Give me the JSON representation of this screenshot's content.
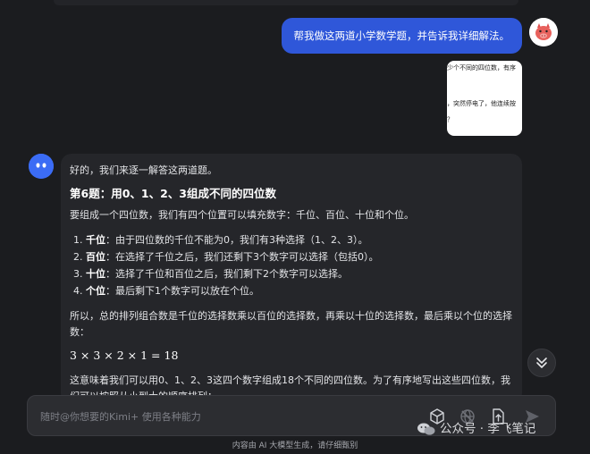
{
  "user_message": "帮我做这两道小学数学题，并告诉我详细解法。",
  "attachment": {
    "lines": [
      "少个不同的四位数，有序",
      "，突然停电了，他连续按",
      "？"
    ]
  },
  "answer": {
    "intro": "好的，我们来逐一解答这两道题。",
    "title": "第6题：用0、1、2、3组成不同的四位数",
    "lead": "要组成一个四位数，我们有四个位置可以填充数字：千位、百位、十位和个位。",
    "steps": [
      {
        "key": "千位",
        "text": "：由于四位数的千位不能为0，我们有3种选择（1、2、3）。"
      },
      {
        "key": "百位",
        "text": "：在选择了千位之后，我们还剩下3个数字可以选择（包括0）。"
      },
      {
        "key": "十位",
        "text": "：选择了千位和百位之后，我们剩下2个数字可以选择。"
      },
      {
        "key": "个位",
        "text": "：最后剩下1个数字可以放在个位。"
      }
    ],
    "summary": "所以，总的排列组合数是千位的选择数乘以百位的选择数，再乘以十位的选择数，最后乘以个位的选择数：",
    "formula": "3 × 3 × 2 × 1 = 18",
    "conclusion": "这意味着我们可以用0、1、2、3这四个数字组成18个不同的四位数。为了有序地写出这些四位数，我们可以按照从小到大的顺序排列："
  },
  "input": {
    "placeholder": "随时@你想要的Kimi+ 使用各种能力"
  },
  "watermark": "公众号 · 李飞笔记",
  "footer_note": "内容由 AI 大模型生成，请仔细甄别",
  "colors": {
    "background": "#1b1c1f",
    "user_bubble": "#2f57d9",
    "card": "#25262a",
    "bot_avatar": "#3b6cf5"
  }
}
